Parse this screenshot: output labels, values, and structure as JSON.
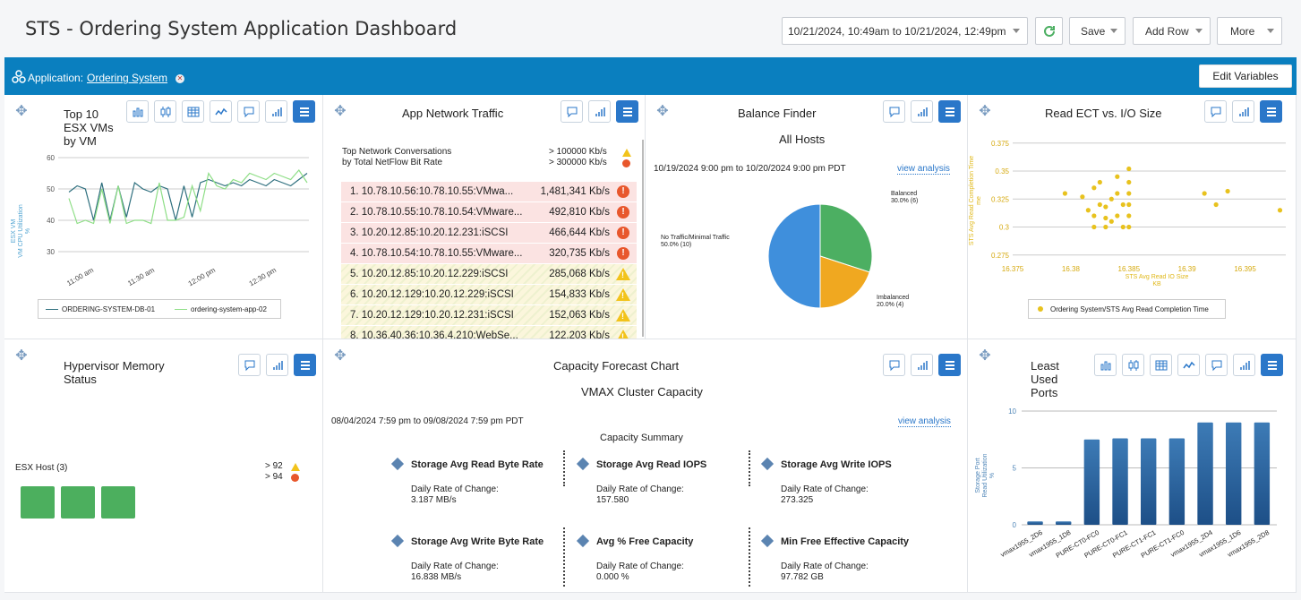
{
  "header": {
    "title": "STS - Ordering System Application Dashboard",
    "time_range": "10/21/2024, 10:49am to 10/21/2024, 12:49pm",
    "save_label": "Save",
    "add_row_label": "Add Row",
    "more_label": "More"
  },
  "appbar": {
    "label": "Application:",
    "value": "Ordering System",
    "edit_label": "Edit Variables"
  },
  "panels": {
    "vms": {
      "title_l1": "Top 10",
      "title_l2": "ESX VMs",
      "title_l3": "by VM",
      "ylabel_l1": "ESX VM",
      "ylabel_l2": "VM CPU Utilization",
      "ylabel_l3": "%",
      "legend": [
        "ORDERING-SYSTEM-DB-01",
        "ordering-system-app-02"
      ]
    },
    "network": {
      "title": "App Network Traffic",
      "sub_l1": "Top Network Conversations",
      "sub_l2": "by Total NetFlow Bit Rate",
      "th_warn": "> 100000 Kb/s",
      "th_crit": "> 300000 Kb/s",
      "rows": [
        {
          "conv": "1. 10.78.10.56:10.78.10.55:VMwa...",
          "rate": "1,481,341 Kb/s"
        },
        {
          "conv": "2. 10.78.10.55:10.78.10.54:VMware...",
          "rate": "492,810 Kb/s"
        },
        {
          "conv": "3. 10.20.12.85:10.20.12.231:iSCSI",
          "rate": "466,644 Kb/s"
        },
        {
          "conv": "4. 10.78.10.54:10.78.10.55:VMware...",
          "rate": "320,735 Kb/s"
        },
        {
          "conv": "5. 10.20.12.85:10.20.12.229:iSCSI",
          "rate": "285,068 Kb/s"
        },
        {
          "conv": "6. 10.20.12.129:10.20.12.229:iSCSI",
          "rate": "154,833 Kb/s"
        },
        {
          "conv": "7. 10.20.12.129:10.20.12.231:iSCSI",
          "rate": "152,063 Kb/s"
        },
        {
          "conv": "8. 10.36.40.36:10.36.4.210:WebSe...",
          "rate": "122,203 Kb/s"
        }
      ]
    },
    "balance": {
      "title": "Balance Finder",
      "subtitle": "All Hosts",
      "range": "10/19/2024 9:00 pm to 10/20/2024 9:00 pm PDT",
      "view_analysis": "view analysis",
      "slice_labels": [
        [
          "Balanced",
          "30.0% (6)"
        ],
        [
          "Imbalanced",
          "20.0% (4)"
        ],
        [
          "No Traffic/Minimal Traffic",
          "50.0% (10)"
        ]
      ]
    },
    "ect": {
      "title": "Read ECT vs. I/O Size",
      "ylabel_l1": "STS Avg Read Completion Time",
      "ylabel_l2": "me",
      "xlabel_l1": "STS Avg Read IO Size",
      "xlabel_l2": "KB",
      "legend": "Ordering System/STS Avg Read Completion Time"
    },
    "hypervisor": {
      "title_l1": "Hypervisor Memory",
      "title_l2": "Status",
      "host_label": "ESX Host (3)",
      "th_warn": "> 92",
      "th_crit": "> 94"
    },
    "capacity": {
      "title": "Capacity Forecast Chart",
      "subtitle": "VMAX Cluster Capacity",
      "range": "08/04/2024 7:59 pm to 09/08/2024 7:59 pm PDT",
      "view_analysis": "view analysis",
      "summary_title": "Capacity Summary",
      "items": [
        {
          "name": "Storage Avg Read Byte Rate",
          "label": "Daily Rate of Change:",
          "value": "3.187 MB/s"
        },
        {
          "name": "Storage Avg Read IOPS",
          "label": "Daily Rate of Change:",
          "value": "157.580"
        },
        {
          "name": "Storage Avg Write IOPS",
          "label": "Daily Rate of Change:",
          "value": "273.325"
        },
        {
          "name": "Storage Avg Write Byte Rate",
          "label": "Daily Rate of Change:",
          "value": "16.838 MB/s"
        },
        {
          "name": "Avg % Free Capacity",
          "label": "Daily Rate of Change:",
          "value": "0.000 %"
        },
        {
          "name": "Min Free Effective Capacity",
          "label": "Daily Rate of Change:",
          "value": "97.782 GB"
        }
      ]
    },
    "ports": {
      "title_l1": "Least",
      "title_l2": "Used",
      "title_l3": "Ports",
      "ylabel_l1": "Storage Port",
      "ylabel_l2": "Read Utilization",
      "ylabel_l3": "%"
    }
  },
  "chart_data": [
    {
      "type": "line",
      "x": [
        "11:00 am",
        "11:30 am",
        "12:00 pm",
        "12:30 pm"
      ],
      "ylim": [
        30,
        60
      ],
      "yticks": [
        30,
        40,
        50,
        60
      ],
      "series": [
        {
          "name": "ORDERING-SYSTEM-DB-01",
          "values": [
            49,
            51,
            50,
            40,
            52,
            40,
            51,
            41,
            52,
            50,
            49,
            51,
            50,
            40,
            51,
            41,
            52,
            53,
            52,
            51,
            52,
            51,
            53,
            52,
            51,
            53,
            52,
            51,
            53,
            55
          ],
          "color": "#2e6f7e"
        },
        {
          "name": "ordering-system-app-02",
          "values": [
            47,
            39,
            40,
            39,
            50,
            39,
            51,
            39,
            40,
            40,
            39,
            52,
            40,
            40,
            41,
            51,
            43,
            55,
            51,
            50,
            53,
            52,
            55,
            54,
            53,
            55,
            54,
            53,
            56,
            52
          ],
          "color": "#8ede86"
        }
      ]
    },
    {
      "type": "pie",
      "categories": [
        "Balanced",
        "Imbalanced",
        "No Traffic/Minimal Traffic"
      ],
      "values": [
        30,
        20,
        50
      ],
      "colors": [
        "#4caf62",
        "#f0a820",
        "#3f8fdc"
      ]
    },
    {
      "type": "scatter",
      "xlim": [
        16.375,
        16.3985
      ],
      "ylim": [
        0.27,
        0.378
      ],
      "xticks": [
        16.375,
        16.38,
        16.385,
        16.39,
        16.395
      ],
      "yticks": [
        0.275,
        0.3,
        0.325,
        0.35,
        0.375
      ],
      "series": [
        {
          "name": "Ordering System/STS Avg Read Completion Time",
          "color": "#e8c21e",
          "points": [
            [
              16.3795,
              0.33
            ],
            [
              16.381,
              0.327
            ],
            [
              16.3815,
              0.315
            ],
            [
              16.382,
              0.3
            ],
            [
              16.382,
              0.335
            ],
            [
              16.382,
              0.31
            ],
            [
              16.3825,
              0.34
            ],
            [
              16.3825,
              0.32
            ],
            [
              16.383,
              0.318
            ],
            [
              16.383,
              0.308
            ],
            [
              16.383,
              0.3
            ],
            [
              16.3835,
              0.325
            ],
            [
              16.3835,
              0.305
            ],
            [
              16.384,
              0.345
            ],
            [
              16.384,
              0.33
            ],
            [
              16.384,
              0.31
            ],
            [
              16.3845,
              0.32
            ],
            [
              16.3845,
              0.3
            ],
            [
              16.385,
              0.352
            ],
            [
              16.385,
              0.34
            ],
            [
              16.385,
              0.33
            ],
            [
              16.385,
              0.32
            ],
            [
              16.385,
              0.31
            ],
            [
              16.385,
              0.3
            ],
            [
              16.3915,
              0.33
            ],
            [
              16.3925,
              0.32
            ],
            [
              16.3935,
              0.332
            ],
            [
              16.398,
              0.315
            ]
          ]
        }
      ]
    },
    {
      "type": "bar",
      "categories": [
        "vmax1955_2D6",
        "vmax1955_1D8",
        "PURE-CT0-FC0",
        "PURE-CT0-FC1",
        "PURE-CT1-FC1",
        "PURE-CT1-FC0",
        "vmax1955_2D4",
        "vmax1955_1D6",
        "vmax1955_2D8"
      ],
      "values": [
        0.3,
        0.3,
        7.5,
        7.6,
        7.6,
        7.6,
        9,
        9,
        9
      ],
      "ylim": [
        0,
        10
      ],
      "yticks": [
        0,
        5,
        10
      ]
    }
  ]
}
